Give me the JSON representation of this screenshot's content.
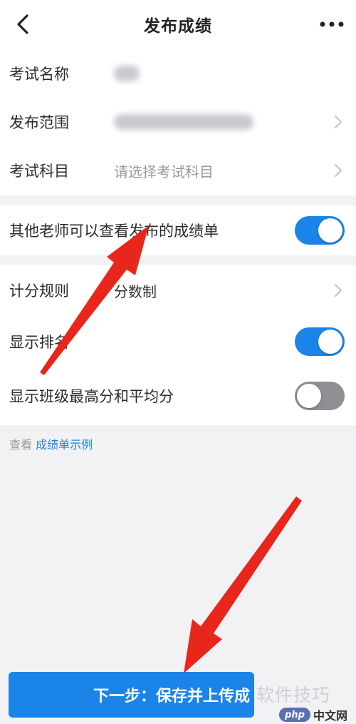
{
  "header": {
    "title": "发布成绩",
    "back_icon": "chevron-left-icon",
    "more_icon": "more-horizontal-icon"
  },
  "exam_info": {
    "name_label": "考试名称",
    "scope_label": "发布范围",
    "subject_label": "考试科目",
    "subject_placeholder": "请选择考试科目"
  },
  "settings": {
    "share_label": "其他老师可以查看发布的成绩单",
    "share_on": true
  },
  "rules": {
    "scoring_label": "计分规则",
    "scoring_value": "分数制",
    "rank_label": "显示排名",
    "rank_on": true,
    "class_stats_label": "显示班级最高分和平均分",
    "class_stats_on": false
  },
  "footnote": {
    "prefix": "查看",
    "link": "成绩单示例"
  },
  "action": {
    "next_label": "下一步：保存并上传成"
  },
  "watermark": {
    "text": "软件技巧",
    "logo": "php",
    "site": "中文网"
  },
  "colors": {
    "accent": "#1a84e8",
    "annotation_arrow": "#e8261b"
  }
}
